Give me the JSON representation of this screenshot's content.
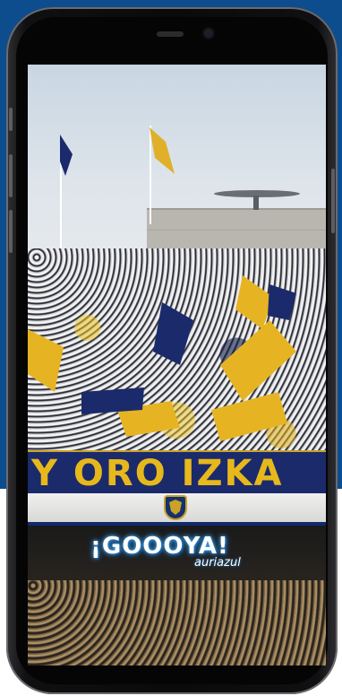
{
  "screen": {
    "banner_text": "Y ORO IZKA",
    "logo": {
      "main": "¡GOOOYA!",
      "sub": "auriazul"
    }
  },
  "colors": {
    "brand_blue": "#1b2a6b",
    "brand_gold": "#e7b81c",
    "background_blue": "#0d4d8e"
  },
  "icons": [
    "pumas-crest-icon"
  ]
}
